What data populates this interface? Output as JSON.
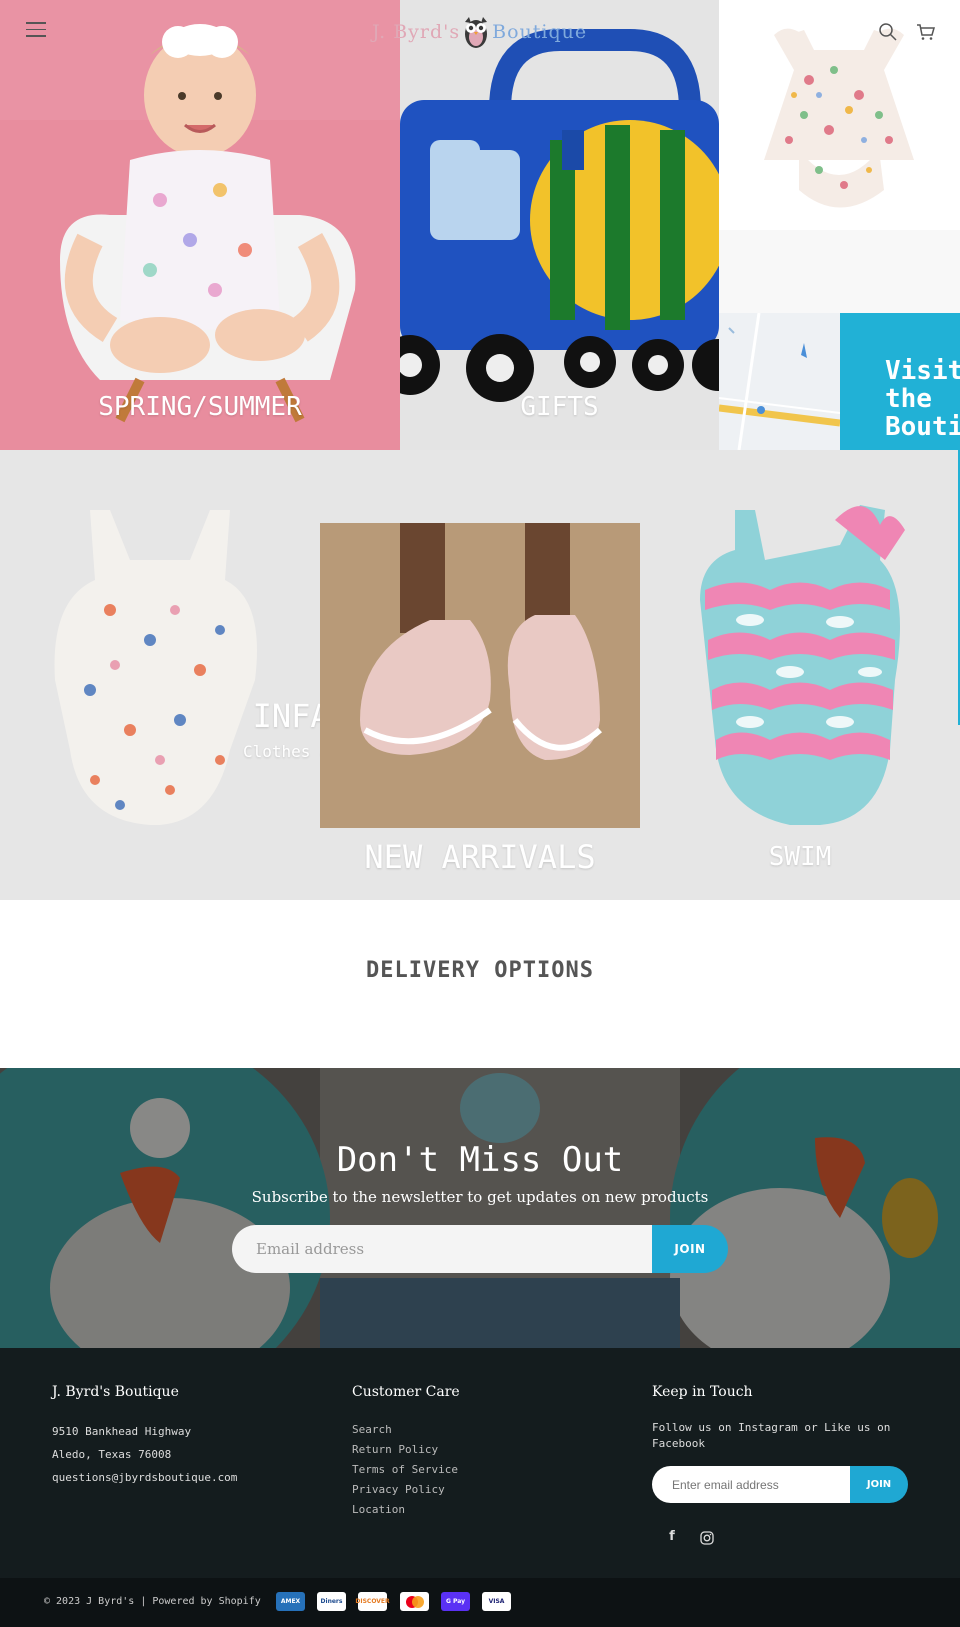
{
  "header": {
    "logo_part1": "J. Byrd's",
    "logo_part2": "Boutique",
    "menu_icon": "hamburger-icon",
    "search_icon": "search-icon",
    "cart_icon": "cart-icon"
  },
  "tiles": {
    "spring_summer": "SPRING/SUMMER",
    "gifts": "GIFTS",
    "visit": "Visit the Boutique",
    "infants_title": "INFANTS",
    "infants_sub": "Clothes and Gear",
    "new_arrivals": "NEW ARRIVALS",
    "swim": "SWIM"
  },
  "delivery": {
    "title": "DELIVERY OPTIONS"
  },
  "newsletter": {
    "title": "Don't Miss Out",
    "subtitle": "Subscribe to the newsletter to get updates on new products",
    "placeholder": "Email address",
    "button": "JOIN"
  },
  "footer": {
    "col1": {
      "title": "J. Byrd's Boutique",
      "address1": "9510 Bankhead Highway",
      "address2": "Aledo, Texas 76008",
      "email": "questions@jbyrdsboutique.com"
    },
    "col2": {
      "title": "Customer Care",
      "links": [
        "Search",
        "Return Policy",
        "Terms of Service",
        "Privacy Policy",
        "Location"
      ]
    },
    "col3": {
      "title": "Keep in Touch",
      "text": "Follow us on Instagram or Like us on Facebook",
      "placeholder": "Enter email address",
      "button": "JOIN",
      "social": [
        "facebook-icon",
        "instagram-icon"
      ]
    }
  },
  "bottom": {
    "copyright": "© 2023 J Byrd's | Powered by Shopify",
    "payments": [
      "AMEX",
      "Diners",
      "DISCOVER",
      "Mastercard",
      "G Pay",
      "VISA"
    ]
  },
  "colors": {
    "accent": "#1fa8d3",
    "footer_bg": "#141c1e",
    "pink_bg": "#e6889a"
  }
}
